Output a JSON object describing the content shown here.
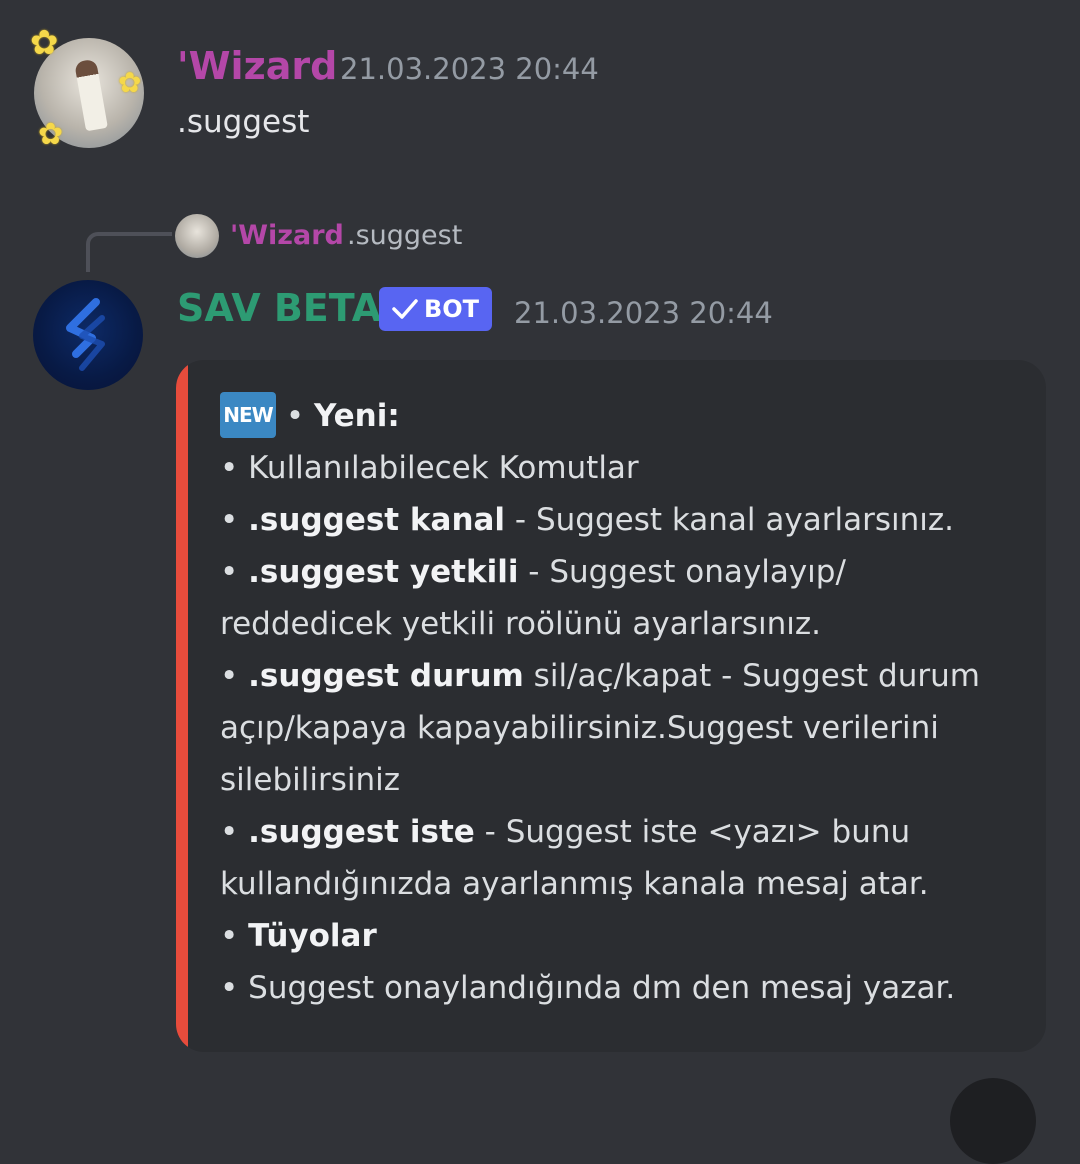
{
  "messages": [
    {
      "author": "'Wizard",
      "timestamp": "21.03.2023 20:44",
      "text": ".suggest"
    }
  ],
  "reply": {
    "author": "'Wizard",
    "text": ".suggest"
  },
  "bot_message": {
    "author": "SAV BETA",
    "badge": "BOT",
    "timestamp": "21.03.2023 20:44",
    "embed": {
      "color": "#e74c3c",
      "new_icon_label": "NEW",
      "lines": [
        {
          "prefix": " • ",
          "bold": "Yeni:",
          "text": ""
        },
        {
          "prefix": "• ",
          "bold": "",
          "text": "Kullanılabilecek Komutlar"
        },
        {
          "prefix": "• ",
          "bold": ".suggest kanal",
          "text": " - Suggest kanal ayarlarsınız."
        },
        {
          "prefix": "• ",
          "bold": ".suggest yetkili",
          "text": " - Suggest onaylayıp/"
        },
        {
          "prefix": "",
          "bold": "",
          "text": "reddedicek yetkili roölünü ayarlarsınız."
        },
        {
          "prefix": "• ",
          "bold": ".suggest durum",
          "text": " sil/aç/kapat - Suggest durum"
        },
        {
          "prefix": "",
          "bold": "",
          "text": "açıp/kapaya kapayabilirsiniz.Suggest verilerini"
        },
        {
          "prefix": "",
          "bold": "",
          "text": "silebilirsiniz"
        },
        {
          "prefix": "• ",
          "bold": ".suggest iste",
          "text": " - Suggest iste <yazı> bunu"
        },
        {
          "prefix": "",
          "bold": "",
          "text": "kullandığınızda ayarlanmış kanala mesaj atar."
        },
        {
          "prefix": "• ",
          "bold": "Tüyolar",
          "text": ""
        },
        {
          "prefix": "• ",
          "bold": "",
          "text": "Suggest onaylandığında dm den mesaj yazar."
        }
      ]
    }
  },
  "colors": {
    "background": "#313338",
    "embed_background": "#2b2d31",
    "username": "#b447a8",
    "bot_name": "#2d9b73",
    "bot_badge": "#5865f2"
  }
}
